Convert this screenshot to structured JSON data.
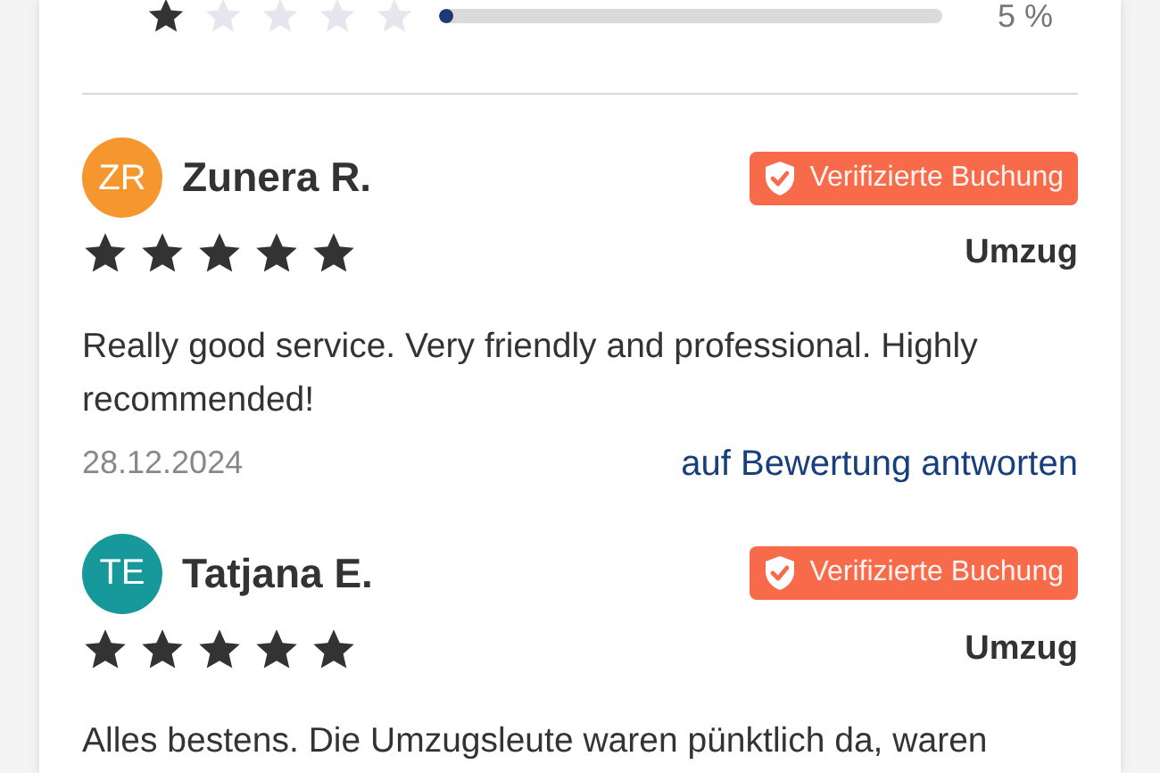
{
  "rating_row": {
    "stars": 1,
    "level": 0.03,
    "percent": "5 %"
  },
  "reviews": [
    {
      "initials": "ZR",
      "color": "#f5962f",
      "name": "Zunera R.",
      "badge": "Verifizierte Buchung",
      "stars": 5,
      "service": "Umzug",
      "text": "Really good service. Very friendly and professional. Highly recommended!",
      "date": "28.12.2024",
      "reply": "auf Bewertung antworten"
    },
    {
      "initials": "TE",
      "color": "#17989a",
      "name": "Tatjana E.",
      "badge": "Verifizierte Buchung",
      "stars": 5,
      "service": "Umzug",
      "text": "Alles bestens. Die Umzugsleute waren pünktlich da, waren"
    }
  ]
}
